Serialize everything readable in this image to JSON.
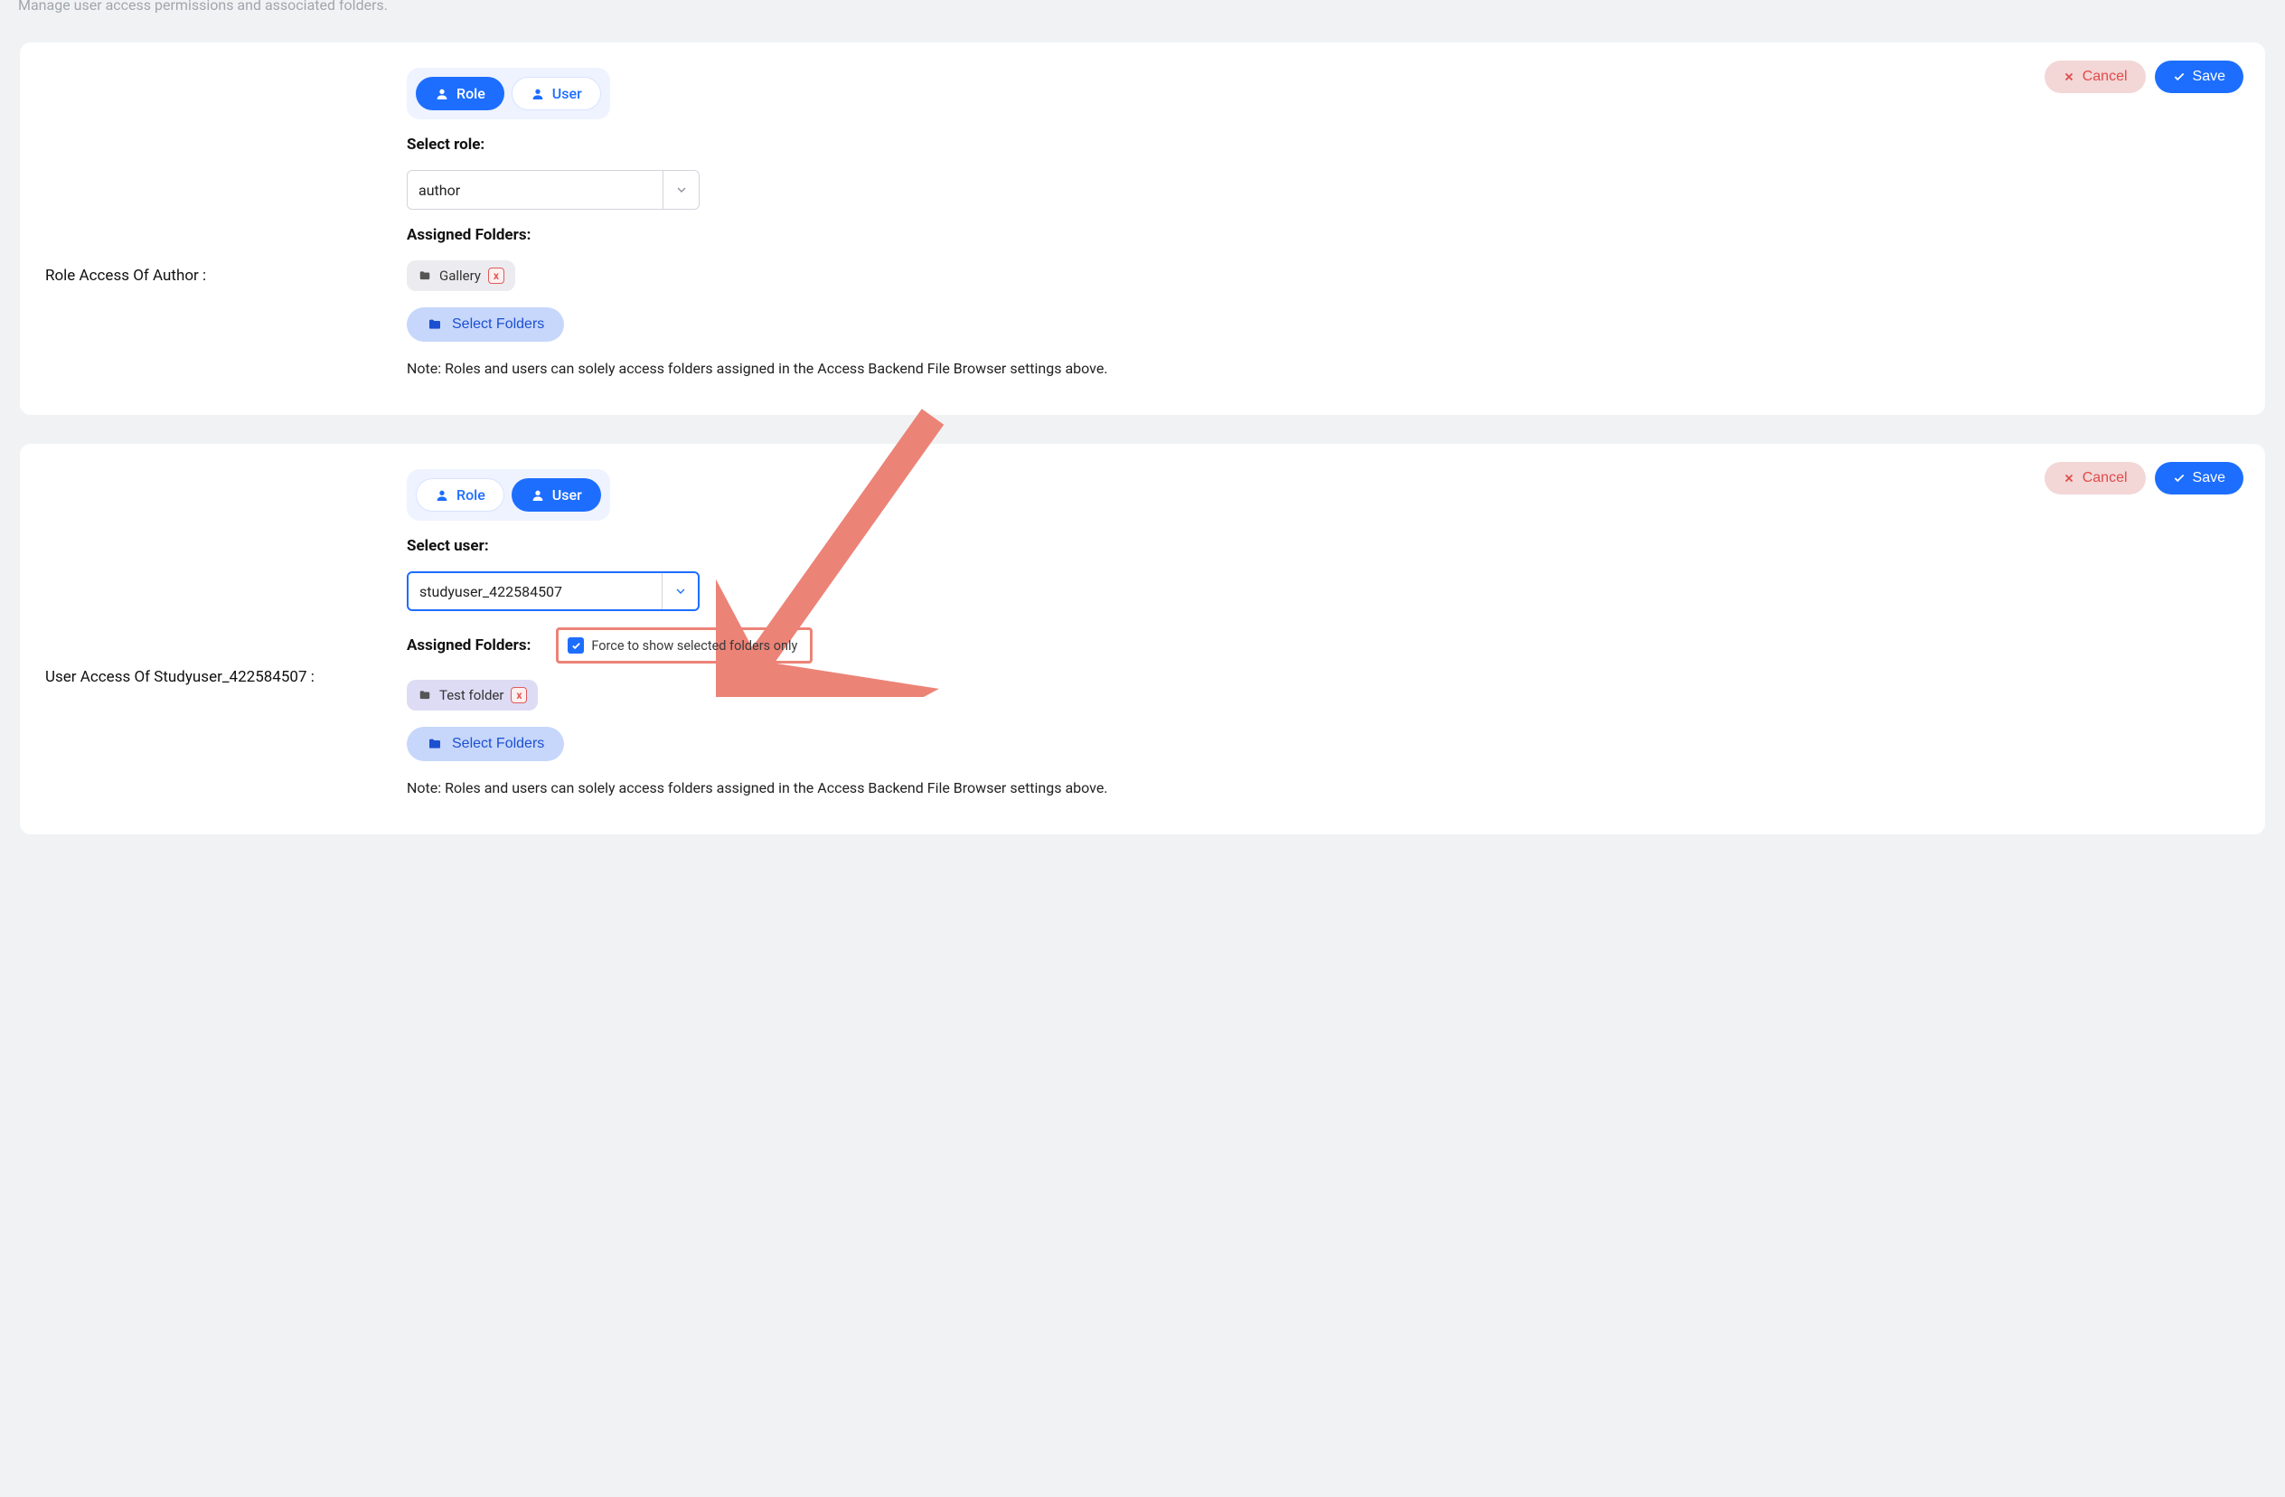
{
  "page": {
    "description": "Manage user access permissions and associated folders."
  },
  "actions": {
    "cancel": "Cancel",
    "save": "Save"
  },
  "toggle": {
    "role": "Role",
    "user": "User"
  },
  "labels": {
    "select_role": "Select role:",
    "select_user": "Select user:",
    "assigned_folders": "Assigned Folders:",
    "select_folders_btn": "Select Folders"
  },
  "card1": {
    "title": "Role Access Of Author :",
    "role_value": "author",
    "folders": [
      {
        "name": "Gallery"
      }
    ],
    "note": "Note: Roles and users can solely access folders assigned in the Access Backend File Browser settings above."
  },
  "card2": {
    "title": "User Access Of Studyuser_422584507 :",
    "user_value": "studyuser_422584507",
    "force_label": "Force to show selected folders only",
    "force_checked": true,
    "folders": [
      {
        "name": "Test folder"
      }
    ],
    "note": "Note: Roles and users can solely access folders assigned in the Access Backend File Browser settings above."
  }
}
